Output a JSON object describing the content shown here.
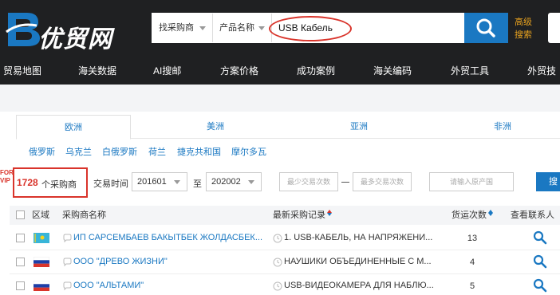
{
  "header": {
    "logo_text": "优贸网",
    "search": {
      "type_select": "找采购商",
      "field_select": "产品名称",
      "query": "USB Кабель"
    },
    "advanced_search_label": "高级搜索"
  },
  "nav": {
    "items": [
      "贸易地图",
      "海关数据",
      "AI搜邮",
      "方案价格",
      "成功案例",
      "海关编码",
      "外贸工具",
      "外贸技"
    ]
  },
  "regions": {
    "tabs": [
      "欧洲",
      "美洲",
      "亚洲",
      "非洲"
    ],
    "active_tab": "欧洲",
    "countries": [
      "俄罗斯",
      "乌克兰",
      "白俄罗斯",
      "荷兰",
      "捷克共和国",
      "摩尔多瓦"
    ]
  },
  "filters": {
    "vip_text": "FOR VIP",
    "buyer_count": "1728",
    "buyer_count_unit": "个采购商",
    "trade_time_label": "交易时间",
    "date_from": "201601",
    "to_label": "至",
    "date_to": "202002",
    "min_trades_placeholder": "最少交易次数",
    "max_trades_placeholder": "最多交易次数",
    "origin_placeholder": "请输入原产国",
    "search_label": "搜"
  },
  "table": {
    "headers": {
      "region": "区域",
      "buyer_name": "采购商名称",
      "latest_record": "最新采购记录",
      "shipments": "货运次数",
      "contacts": "查看联系人"
    },
    "rows": [
      {
        "flag": "kazakhstan-flag",
        "buyer": "ИП САРСЕМБАЕВ БАКЫТБЕК ЖОЛДАСБЕК...",
        "record": "1. USB-КАБЕЛЬ, НА НАПРЯЖЕНИ...",
        "shipments": "13"
      },
      {
        "flag": "russia-flag",
        "buyer": "ООО \"ДРЕВО ЖИЗНИ\"",
        "record": "НАУШИКИ ОБЪЕДИНЕННЫЕ С М...",
        "shipments": "4"
      },
      {
        "flag": "russia-flag",
        "buyer": "ООО \"АЛЬТАМИ\"",
        "record": "USB-ВИДЕОКАМЕРА ДЛЯ НАБЛЮ...",
        "shipments": "5"
      }
    ]
  },
  "colors": {
    "header_bg": "#1f2022",
    "accent_blue": "#1a78c2",
    "highlight_red": "#d9342b",
    "advanced_orange": "#e8a21f"
  }
}
